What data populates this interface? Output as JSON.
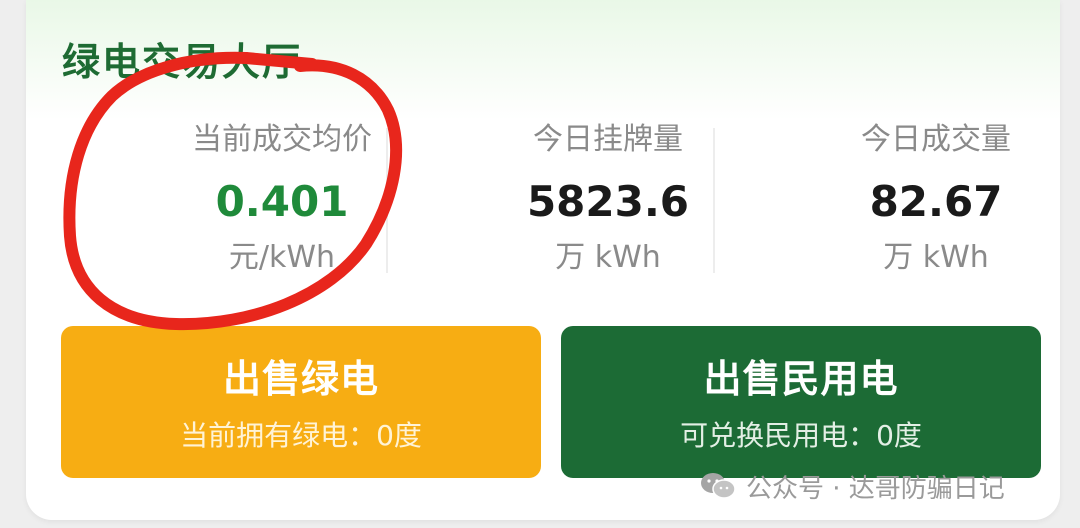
{
  "panel": {
    "title": "绿电交易大厅"
  },
  "stats": [
    {
      "label": "当前成交均价",
      "value": "0.401",
      "unit": "元/kWh"
    },
    {
      "label": "今日挂牌量",
      "value": "5823.6",
      "unit": "万 kWh"
    },
    {
      "label": "今日成交量",
      "value": "82.67",
      "unit": "万 kWh"
    }
  ],
  "actions": {
    "sell_green": {
      "label": "出售绿电",
      "sub": "当前拥有绿电：0度"
    },
    "sell_civil": {
      "label": "出售民用电",
      "sub": "可兑换民用电：0度"
    }
  },
  "watermark": {
    "icon": "wechat-icon",
    "text": "公众号 · 达哥防骗日记"
  },
  "colors": {
    "title_green": "#1e6b33",
    "price_green": "#1f8a3a",
    "sell_green_button": "#f7ad13",
    "sell_civil_button": "#1c6b35",
    "annotation_red": "#e8261c"
  }
}
